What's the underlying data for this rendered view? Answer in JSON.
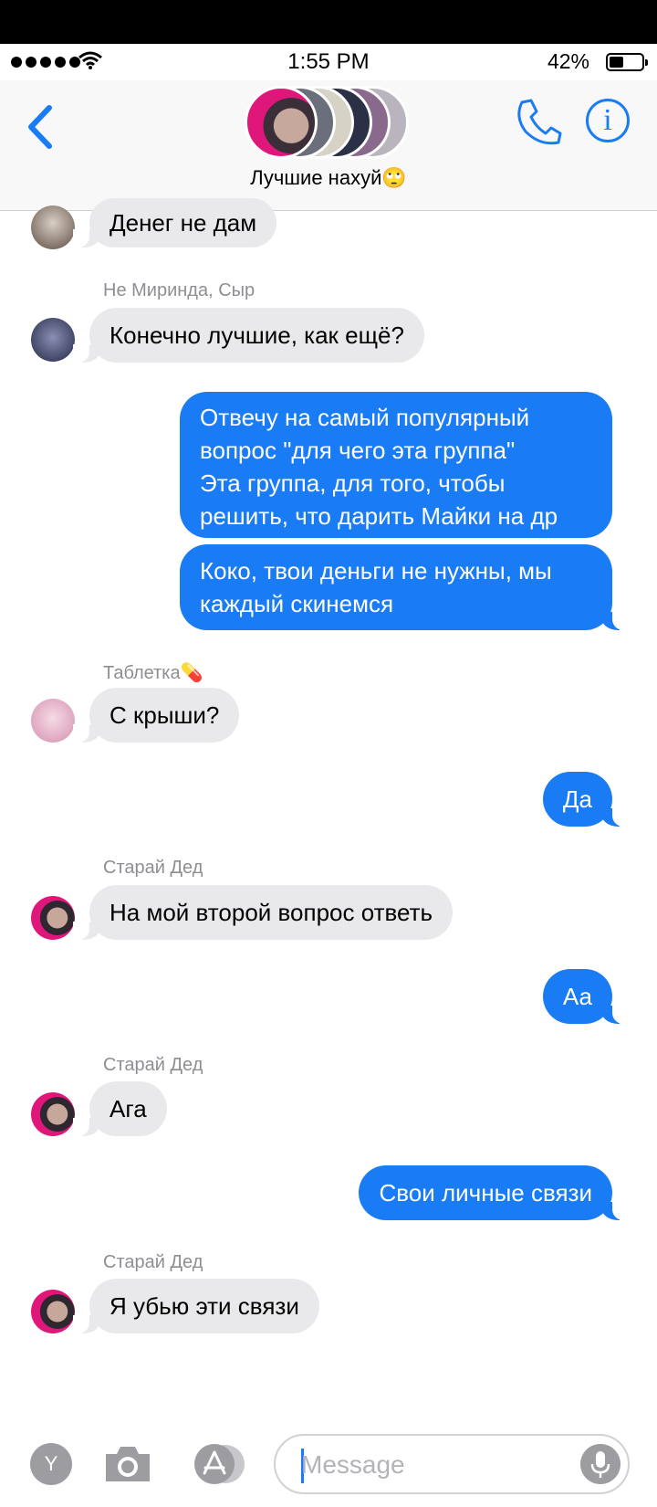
{
  "status_bar": {
    "time": "1:55 PM",
    "battery": "42%"
  },
  "header": {
    "group_name": "Лучшие нахуй🙄",
    "back_icon": "chevron-left-icon",
    "call_icon": "phone-icon",
    "info_icon": "info-icon",
    "info_label": "i",
    "accent_color": "#1a7cf5"
  },
  "messages": [
    {
      "direction": "in",
      "sender": "",
      "text": "Денег не дам"
    },
    {
      "direction": "in",
      "sender": "Не Миринда, Сыр",
      "text": "Конечно лучшие, как ещё?"
    },
    {
      "direction": "out",
      "text": "Отвечу на самый популярный\nвопрос \"для чего эта группа\"\nЭта группа, для того, чтобы\nрешить, что дарить Майки на др"
    },
    {
      "direction": "out",
      "text": "Коко, твои деньги не нужны, мы\nкаждый скинемся"
    },
    {
      "direction": "in",
      "sender": "Таблетка💊",
      "text": "С крыши?"
    },
    {
      "direction": "out",
      "text": "Да"
    },
    {
      "direction": "in",
      "sender": "Старай Дед",
      "text": "На мой второй вопрос ответь"
    },
    {
      "direction": "out",
      "text": "Аа"
    },
    {
      "direction": "in",
      "sender": "Старай Дед",
      "text": "Ага"
    },
    {
      "direction": "out",
      "text": "Свои личные связи"
    },
    {
      "direction": "in",
      "sender": "Старай Дед",
      "text": "Я убью эти связи"
    }
  ],
  "input_bar": {
    "placeholder": "Message",
    "value": "",
    "y_label": "Y",
    "camera_icon": "camera-icon",
    "apps_icon": "app-store-icon",
    "mic_icon": "microphone-icon"
  }
}
